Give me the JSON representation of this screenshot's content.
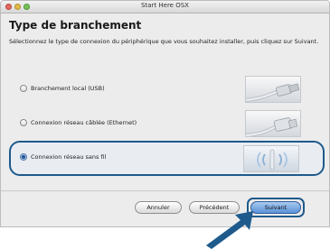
{
  "window": {
    "title": "Start Here OSX"
  },
  "heading": "Type de branchement",
  "instructions": "Sélectionnez le type de connexion du périphérique que vous souhaitez installer, puis cliquez sur Suivant.",
  "options": [
    {
      "label": "Branchement local (USB)",
      "selected": false,
      "icon": "usb-cable-icon"
    },
    {
      "label": "Connexion réseau câblée (Ethernet)",
      "selected": false,
      "icon": "ethernet-cable-icon"
    },
    {
      "label": "Connexion réseau sans fil",
      "selected": true,
      "icon": "wireless-icon"
    }
  ],
  "buttons": {
    "cancel": "Annuler",
    "previous": "Précédent",
    "next": "Suivant"
  },
  "colors": {
    "highlight": "#1e5a8c",
    "primary_button": "#5a92d8"
  }
}
